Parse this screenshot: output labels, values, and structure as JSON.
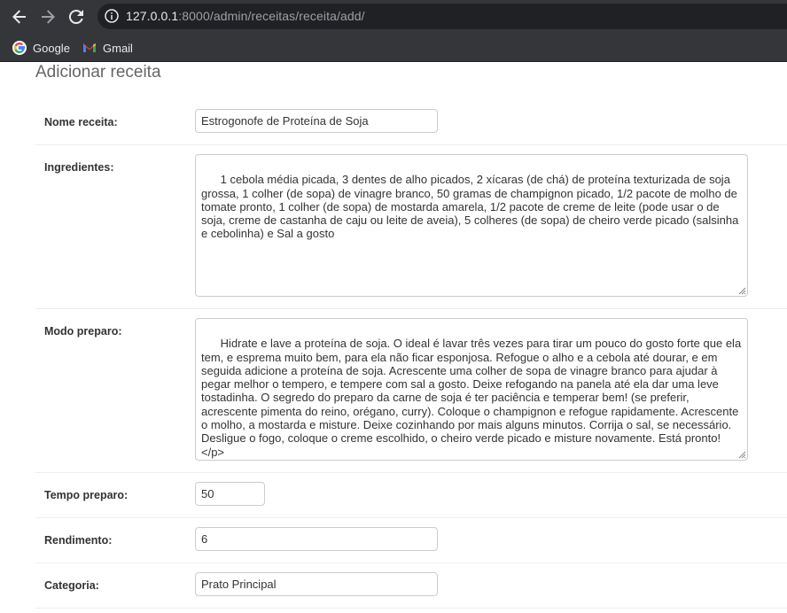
{
  "browser": {
    "url_host": "127.0.0.1",
    "url_rest": ":8000/admin/receitas/receita/add/",
    "bookmarks": [
      {
        "label": "Google",
        "icon": "google-icon"
      },
      {
        "label": "Gmail",
        "icon": "gmail-icon"
      }
    ]
  },
  "page": {
    "title": "Adicionar receita"
  },
  "form": {
    "nome": {
      "label": "Nome receita:",
      "value": "Estrogonofe de Proteína de Soja"
    },
    "ingredientes": {
      "label": "Ingredientes:",
      "value": "1 cebola média picada, 3 dentes de alho picados, 2 xícaras (de chá) de proteína texturizada de soja grossa, 1 colher (de sopa) de vinagre branco, 50 gramas de champignon picado, 1/2 pacote de molho de tomate pronto, 1 colher (de sopa) de mostarda amarela, 1/2 pacote de creme de leite (pode usar o de soja, creme de castanha de caju ou leite de aveia), 5 colheres (de sopa) de cheiro verde picado (salsinha e cebolinha) e Sal a gosto"
    },
    "modo": {
      "label": "Modo preparo:",
      "value": "Hidrate e lave a proteína de soja. O ideal é lavar três vezes para tirar um pouco do gosto forte que ela tem, e esprema muito bem, para ela não ficar esponjosa. Refogue o alho e a cebola até dourar, e em seguida adicione a proteína de soja. Acrescente uma colher de sopa de vinagre branco para ajudar à pegar melhor o tempero, e tempere com sal a gosto. Deixe refogando na panela até ela dar uma leve tostadinha. O segredo do preparo da carne de soja é ter paciência e temperar bem! (se preferir, acrescente pimenta do reino, orégano, curry). Coloque o champignon e refogue rapidamente. Acrescente o molho, a mostarda e misture. Deixe cozinhando por mais alguns minutos. Corrija o sal, se necessário. Desligue o fogo, coloque o creme escolhido, o cheiro verde picado e misture novamente. Está pronto!</p>"
    },
    "tempo": {
      "label": "Tempo preparo:",
      "value": "50"
    },
    "rendimento": {
      "label": "Rendimento:",
      "value": "6"
    },
    "categoria": {
      "label": "Categoria:",
      "value": "Prato Principal"
    }
  }
}
